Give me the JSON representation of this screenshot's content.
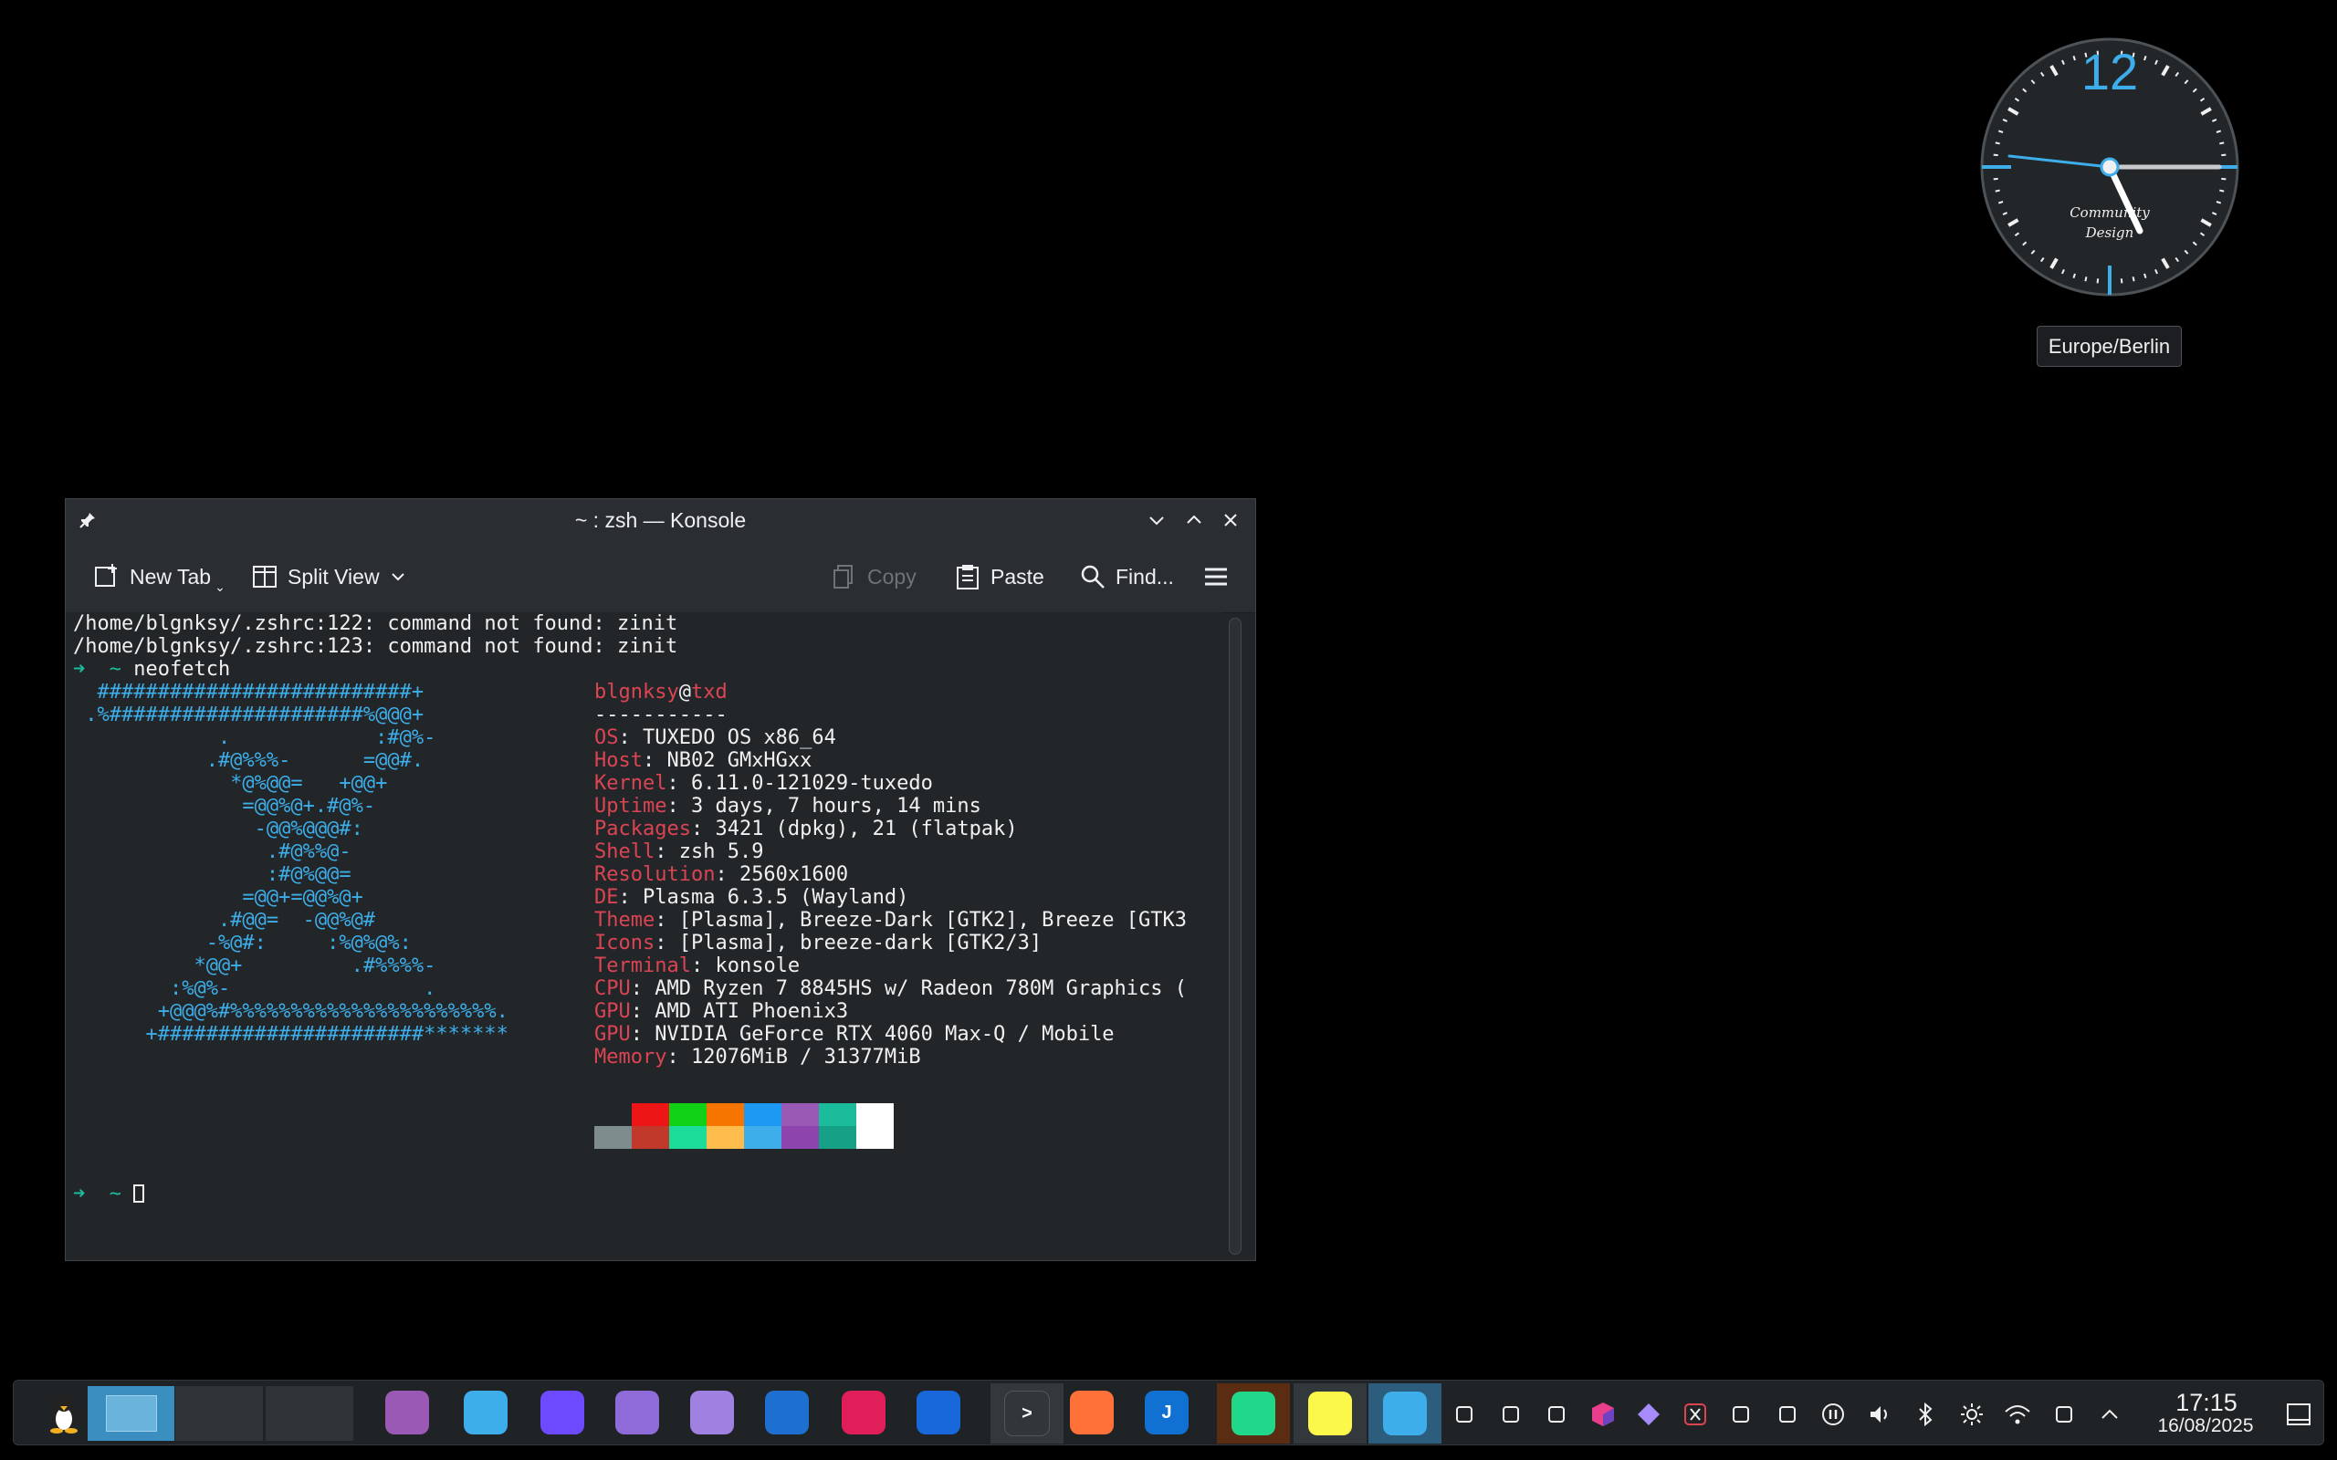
{
  "clock": {
    "twelve": "12",
    "brand_line1": "Community",
    "brand_line2": "Design",
    "timezone": "Europe/Berlin",
    "accent": "#3daee9"
  },
  "window": {
    "title": "~ : zsh — Konsole",
    "toolbar": {
      "new_tab": "New Tab",
      "split_view": "Split View",
      "copy": "Copy",
      "paste": "Paste",
      "find": "Find..."
    }
  },
  "terminal": {
    "err1": "/home/blgnksy/.zshrc:122: command not found: zinit",
    "err2": "/home/blgnksy/.zshrc:123: command not found: zinit",
    "prompt_arrow": "➜",
    "prompt_dir": "~",
    "command": "neofetch",
    "user": "blgnksy",
    "at": "@",
    "host": "txd",
    "separator": "-----------",
    "art": [
      "  ##########################+",
      " .%#####################%@@@+",
      "            .            :#@%-",
      "           .#@%%%-      =@@#.",
      "             *@%@@=   +@@+",
      "              =@@%@+.#@%-",
      "               -@@%@@@#:",
      "                .#@%%@-",
      "                :#@%@@=",
      "              =@@+=@@%@+",
      "            .#@@=  -@@%@#",
      "           -%@#:     :%@%@%:",
      "          *@@+         .#%%%%-",
      "        :%@%-                .",
      "       +@@@%#%%%%%%%%%%%%%%%%%%%%%%.",
      "      +######################*******"
    ],
    "info": [
      {
        "label": "OS",
        "value": ": TUXEDO OS x86_64"
      },
      {
        "label": "Host",
        "value": ": NB02 GMxHGxx"
      },
      {
        "label": "Kernel",
        "value": ": 6.11.0-121029-tuxedo"
      },
      {
        "label": "Uptime",
        "value": ": 3 days, 7 hours, 14 mins"
      },
      {
        "label": "Packages",
        "value": ": 3421 (dpkg), 21 (flatpak)"
      },
      {
        "label": "Shell",
        "value": ": zsh 5.9"
      },
      {
        "label": "Resolution",
        "value": ": 2560x1600"
      },
      {
        "label": "DE",
        "value": ": Plasma 6.3.5 (Wayland)"
      },
      {
        "label": "Theme",
        "value": ": [Plasma], Breeze-Dark [GTK2], Breeze [GTK3"
      },
      {
        "label": "Icons",
        "value": ": [Plasma], breeze-dark [GTK2/3]"
      },
      {
        "label": "Terminal",
        "value": ": konsole"
      },
      {
        "label": "CPU",
        "value": ": AMD Ryzen 7 8845HS w/ Radeon 780M Graphics ("
      },
      {
        "label": "GPU",
        "value": ": AMD ATI Phoenix3"
      },
      {
        "label": "GPU",
        "value": ": NVIDIA GeForce RTX 4060 Max-Q / Mobile"
      },
      {
        "label": "Memory",
        "value": ": 12076MiB / 31377MiB"
      }
    ],
    "palette_top": [
      "#232629",
      "#ed1515",
      "#11d116",
      "#f67400",
      "#1d99f3",
      "#9b59b6",
      "#1abc9c",
      "#ffffff"
    ],
    "palette_bottom": [
      "#7f8c8d",
      "#c0392b",
      "#1cdc9a",
      "#fdbc4b",
      "#3daee9",
      "#8e44ad",
      "#16a085",
      "#ffffff"
    ]
  },
  "taskbar": {
    "time": "17:15",
    "date": "16/08/2025",
    "apps": [
      "tux-icon",
      "pager-desktop-1",
      "pager-desktop-2",
      "pager-desktop-3",
      "folder-icon",
      "dolphin-icon",
      "proton-vpn-icon",
      "mail-icon",
      "launcher-icon",
      "thunderbird-icon",
      "slack-icon",
      "jira-icon",
      "konsole-icon",
      "firefox-icon",
      "joplin-icon",
      "clion-icon",
      "pycharm-icon",
      "spectacle-icon"
    ]
  }
}
